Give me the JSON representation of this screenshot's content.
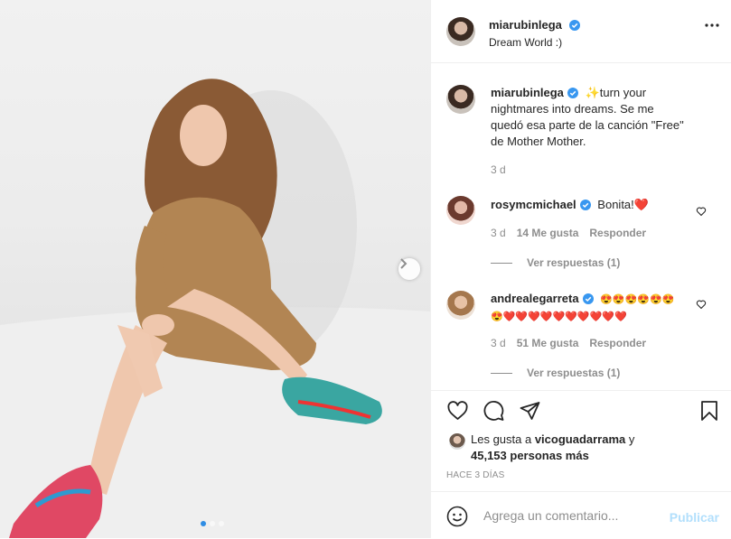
{
  "post": {
    "author": "miarubinlega",
    "location": "Dream World :)",
    "caption_line1": "✨turn your",
    "caption_line2": "nightmares into dreams. Se me",
    "caption_line3": "quedó esa parte de la canción \"Free\"",
    "caption_line4": "de Mother Mother.",
    "caption_time": "3 d",
    "image_count": 3,
    "active_image": 1
  },
  "comments": [
    {
      "user": "rosymcmichael",
      "text": "Bonita!❤️",
      "time": "3 d",
      "likes": "14 Me gusta",
      "reply": "Responder",
      "view_replies": "Ver respuestas (1)"
    },
    {
      "user": "andrealegarreta",
      "text_line1": "😍😍😍😍😍😍",
      "text_line2": "😍❤️❤️❤️❤️❤️❤️❤️❤️❤️❤️",
      "time": "3 d",
      "likes": "51 Me gusta",
      "reply": "Responder",
      "view_replies": "Ver respuestas (1)"
    }
  ],
  "likes": {
    "prefix": "Les gusta a ",
    "user": "vicoguadarrama",
    "suffix": " y",
    "count": "45,153 personas más"
  },
  "posted_ago": "HACE 3 DÍAS",
  "composer": {
    "placeholder": "Agrega un comentario...",
    "publish": "Publicar"
  },
  "colors": {
    "verified": "#3897f0",
    "publish_disabled": "#b2dffc",
    "heart_red": "#d0021b",
    "text_primary": "#262626",
    "text_secondary": "#8e8e8e"
  },
  "icons": [
    "more-options-icon",
    "like-icon",
    "comment-icon",
    "share-icon",
    "save-icon",
    "emoji-icon",
    "next-arrow-icon",
    "verified-icon"
  ]
}
